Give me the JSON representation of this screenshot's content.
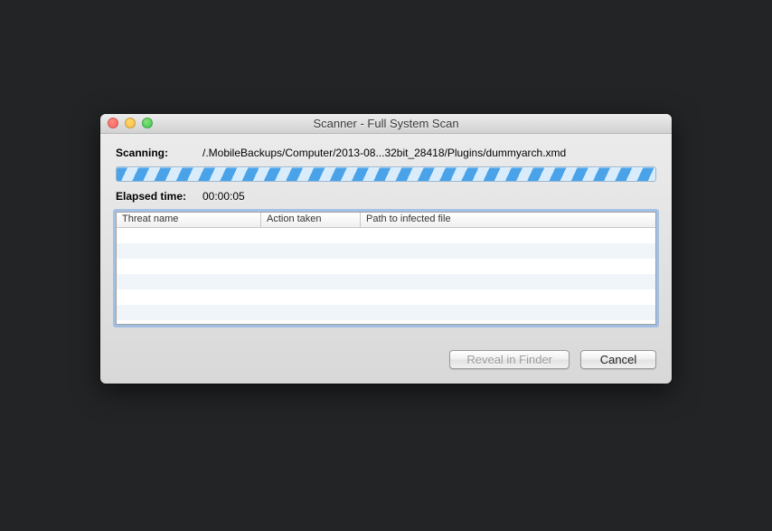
{
  "window": {
    "title": "Scanner - Full System Scan"
  },
  "scan": {
    "scanning_label": "Scanning:",
    "current_path": "/.MobileBackups/Computer/2013-08...32bit_28418/Plugins/dummyarch.xmd",
    "elapsed_label": "Elapsed time:",
    "elapsed_value": "00:00:05"
  },
  "table": {
    "columns": {
      "threat_name": "Threat name",
      "action_taken": "Action taken",
      "path": "Path to infected file"
    },
    "rows": []
  },
  "buttons": {
    "reveal": "Reveal in Finder",
    "cancel": "Cancel"
  }
}
